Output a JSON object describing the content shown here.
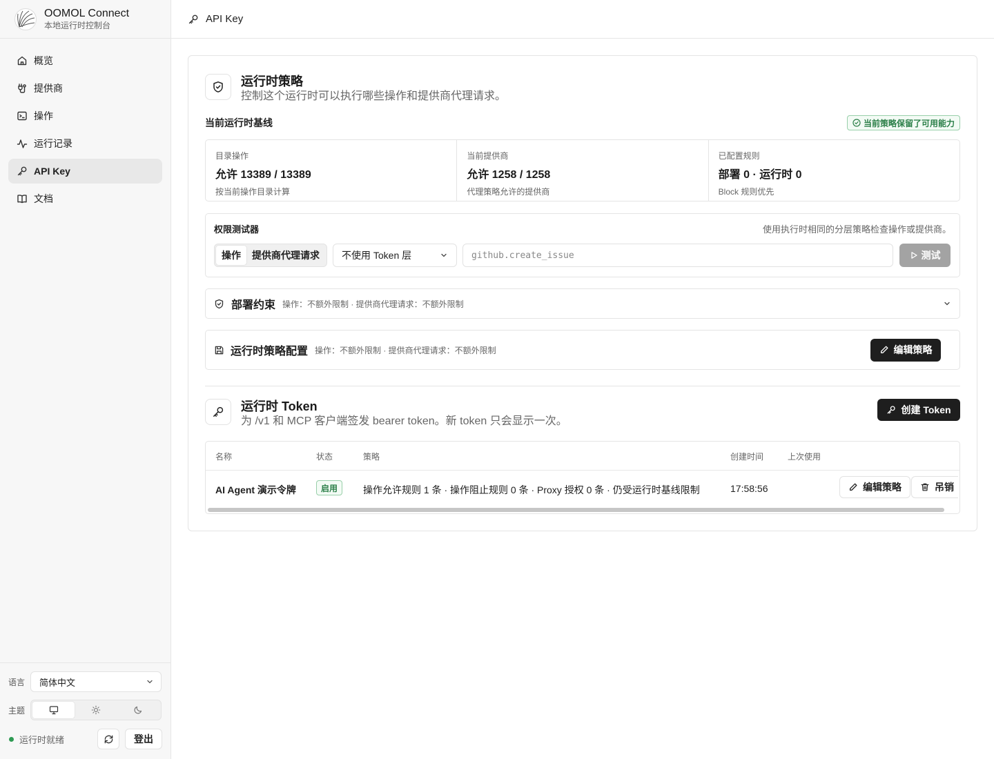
{
  "brand": {
    "title": "OOMOL Connect",
    "subtitle": "本地运行时控制台"
  },
  "nav": [
    {
      "label": "概览",
      "icon": "home-icon"
    },
    {
      "label": "提供商",
      "icon": "plug-icon"
    },
    {
      "label": "操作",
      "icon": "terminal-icon"
    },
    {
      "label": "运行记录",
      "icon": "activity-icon"
    },
    {
      "label": "API Key",
      "icon": "key-icon",
      "active": true
    },
    {
      "label": "文档",
      "icon": "book-icon"
    }
  ],
  "sidebar_bottom": {
    "language_label": "语言",
    "language_value": "简体中文",
    "theme_label": "主题",
    "theme_options": [
      "monitor-icon",
      "sun-icon",
      "moon-icon"
    ],
    "theme_active": "monitor-icon",
    "status_text": "运行时就绪",
    "status_color": "#2e9a53",
    "logout_label": "登出"
  },
  "topbar": {
    "title": "API Key"
  },
  "policy": {
    "title": "运行时策略",
    "description": "控制这个运行时可以执行哪些操作和提供商代理请求。",
    "baseline_title": "当前运行时基线",
    "baseline_badge": "当前策略保留了可用能力",
    "stats": [
      {
        "label": "目录操作",
        "value": "允许 13389 / 13389",
        "note": "按当前操作目录计算"
      },
      {
        "label": "当前提供商",
        "value": "允许 1258 / 1258",
        "note": "代理策略允许的提供商"
      },
      {
        "label": "已配置规则",
        "value": "部署 0 · 运行时 0",
        "note": "Block 规则优先"
      }
    ],
    "tester": {
      "title": "权限测试器",
      "hint": "使用执行时相同的分层策略检查操作或提供商。",
      "mode_options": [
        "操作",
        "提供商代理请求"
      ],
      "mode_active": "操作",
      "token_layer": "不使用 Token 层",
      "input_placeholder": "github.create_issue",
      "test_label": "测试"
    },
    "deploy": {
      "title": "部署约束",
      "summary": "操作：不额外限制 · 提供商代理请求：不额外限制"
    },
    "runtime_config": {
      "title": "运行时策略配置",
      "summary": "操作：不额外限制 · 提供商代理请求：不额外限制",
      "edit_label": "编辑策略"
    }
  },
  "tokens": {
    "title": "运行时 Token",
    "description": "为 /v1 和 MCP 客户端签发 bearer token。新 token 只会显示一次。",
    "create_label": "创建 Token",
    "columns": [
      "名称",
      "状态",
      "策略",
      "创建时间",
      "上次使用"
    ],
    "rows": [
      {
        "name": "AI Agent 演示令牌",
        "status": "启用",
        "policy": "操作允许规则 1 条 · 操作阻止规则 0 条 · Proxy 授权 0 条 · 仍受运行时基线限制",
        "created": "17:58:56",
        "last_used": "",
        "edit_label": "编辑策略",
        "revoke_label": "吊销"
      }
    ]
  },
  "colors": {
    "accent_dark": "#1e1e1e",
    "success": "#2b7f48",
    "disabled": "#a3a3a3"
  }
}
